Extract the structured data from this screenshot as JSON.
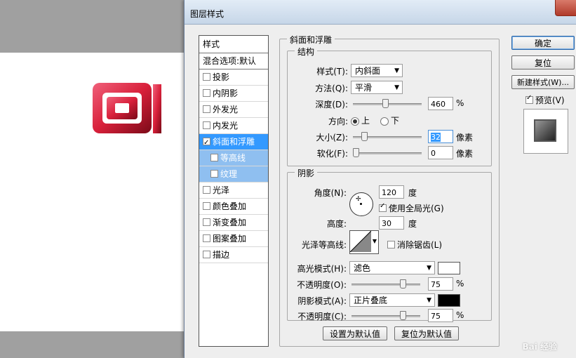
{
  "dialog": {
    "title": "图层样式"
  },
  "styles_list": {
    "header": "样式",
    "blend": "混合选项:默认",
    "items": [
      {
        "label": "投影",
        "checked": false,
        "state": "normal"
      },
      {
        "label": "内阴影",
        "checked": false,
        "state": "normal"
      },
      {
        "label": "外发光",
        "checked": false,
        "state": "normal"
      },
      {
        "label": "内发光",
        "checked": false,
        "state": "normal"
      },
      {
        "label": "斜面和浮雕",
        "checked": true,
        "state": "selected"
      },
      {
        "label": "等高线",
        "checked": false,
        "state": "sub"
      },
      {
        "label": "纹理",
        "checked": false,
        "state": "sub"
      },
      {
        "label": "光泽",
        "checked": false,
        "state": "normal"
      },
      {
        "label": "颜色叠加",
        "checked": false,
        "state": "normal"
      },
      {
        "label": "渐变叠加",
        "checked": false,
        "state": "normal"
      },
      {
        "label": "图案叠加",
        "checked": false,
        "state": "normal"
      },
      {
        "label": "描边",
        "checked": false,
        "state": "normal"
      }
    ]
  },
  "bevel": {
    "section_title": "斜面和浮雕",
    "structure_title": "结构",
    "style_label": "样式(T):",
    "style_value": "内斜面",
    "method_label": "方法(Q):",
    "method_value": "平滑",
    "depth_label": "深度(D):",
    "depth_value": "460",
    "depth_unit": "%",
    "depth_level": 0.46,
    "direction_label": "方向:",
    "direction_up": "上",
    "direction_down": "下",
    "size_label": "大小(Z):",
    "size_value": "32",
    "size_unit": "像素",
    "size_level": 0.13,
    "soften_label": "软化(F):",
    "soften_value": "0",
    "soften_unit": "像素",
    "soften_level": 0.0
  },
  "shading": {
    "title": "阴影",
    "angle_label": "角度(N):",
    "angle_value": "120",
    "angle_unit": "度",
    "global_light_label": "使用全局光(G)",
    "altitude_label": "高度:",
    "altitude_value": "30",
    "altitude_unit": "度",
    "gloss_contour_label": "光泽等高线:",
    "antialias_label": "消除锯齿(L)",
    "highlight_mode_label": "高光模式(H):",
    "highlight_mode_value": "滤色",
    "highlight_color": "#ffffff",
    "highlight_opacity_label": "不透明度(O):",
    "highlight_opacity_value": "75",
    "highlight_opacity_unit": "%",
    "shadow_mode_label": "阴影模式(A):",
    "shadow_mode_value": "正片叠底",
    "shadow_color": "#000000",
    "shadow_opacity_label": "不透明度(C):",
    "shadow_opacity_value": "75",
    "shadow_opacity_unit": "%",
    "opacity_level": 0.75
  },
  "buttons": {
    "ok": "确定",
    "reset": "复位",
    "new_style": "新建样式(W)...",
    "preview_label": "预览(V)",
    "set_default": "设置为默认值",
    "reset_default": "复位为默认值"
  },
  "watermark": "Bai 经验",
  "colors": {
    "accent": "#3399ff",
    "logo": "#d8203a"
  }
}
